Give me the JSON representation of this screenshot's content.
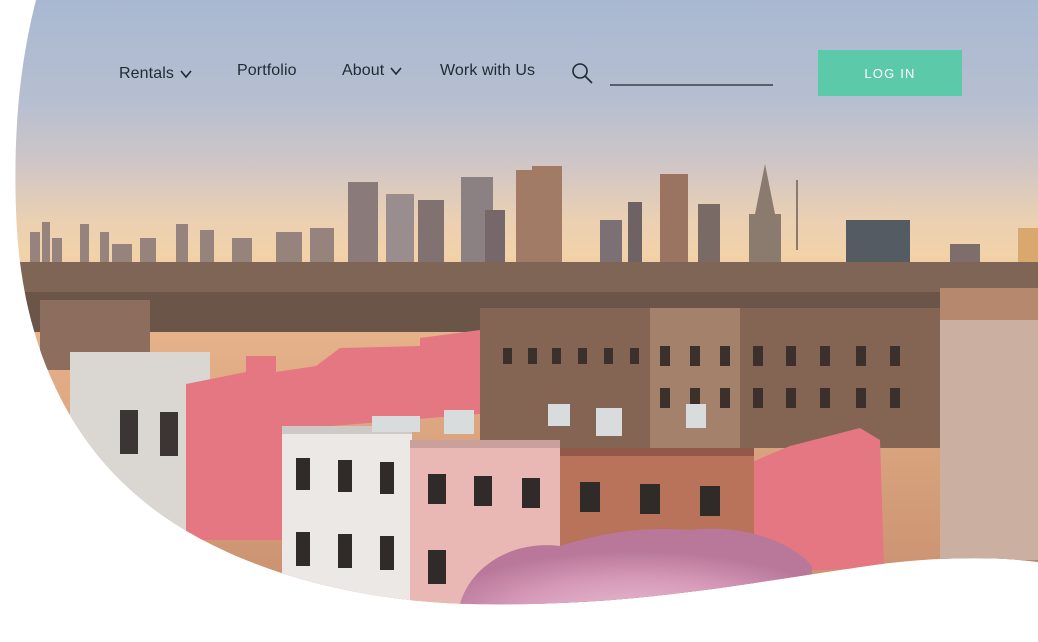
{
  "nav": {
    "items": [
      {
        "label": "Rentals",
        "dropdown": true,
        "icon": "chevron-down-icon"
      },
      {
        "label": "Portfolio",
        "dropdown": false
      },
      {
        "label": "About",
        "dropdown": true,
        "icon": "chevron-down-icon"
      },
      {
        "label": "Work with Us",
        "dropdown": false
      }
    ],
    "search": {
      "icon": "search-icon",
      "placeholder": "",
      "value": ""
    },
    "login_label": "LOG IN"
  },
  "colors": {
    "accent": "#5ccaa9",
    "nav_text": "#1f2a33",
    "pink_highlight": "#e47781",
    "background": "#ffffff"
  },
  "hero": {
    "image": "city skyline with brownstone rooftops at sunset",
    "shape": "wave-clipped photo"
  }
}
